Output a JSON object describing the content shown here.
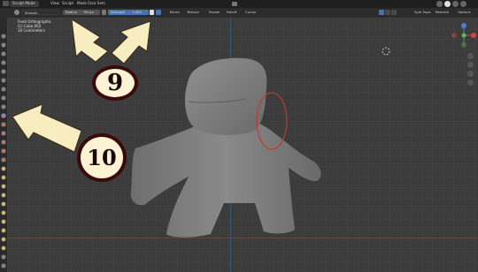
{
  "header": {
    "mode_label": "Sculpt Mode",
    "menus": [
      "View",
      "Sculpt",
      "Mask",
      "Face Sets"
    ],
    "right_controls": [
      "Sym Exps",
      "Remesh",
      "Options"
    ]
  },
  "toolbar": {
    "brush_name": "Smooth",
    "radius_label": "Radius",
    "radius_value": "99 px",
    "strength_label": "Strength",
    "strength_value": "1.000",
    "menus": [
      "Brush",
      "Texture",
      "Stroke",
      "Falloff",
      "Cursor"
    ]
  },
  "viewport": {
    "view_name": "Front Orthographic",
    "object_name": "(1) Cube.003",
    "scale_text": "10 Centimeters"
  },
  "annotations": {
    "label_9": "9",
    "label_10": "10",
    "arrow_color": "#f7edc0",
    "circle_border_color": "#3a0b0b",
    "highlight_ring_color": "#c0392b"
  },
  "icons": {
    "mode_icon": "sculpt-mode-icon",
    "brush_icon": "smooth-brush-icon",
    "pressure_icon": "pen-pressure-icon",
    "gizmo": "navigation-gizmo",
    "zoom": "zoom-icon",
    "pan": "pan-hand-icon",
    "camera": "camera-icon",
    "grid": "grid-icon"
  }
}
